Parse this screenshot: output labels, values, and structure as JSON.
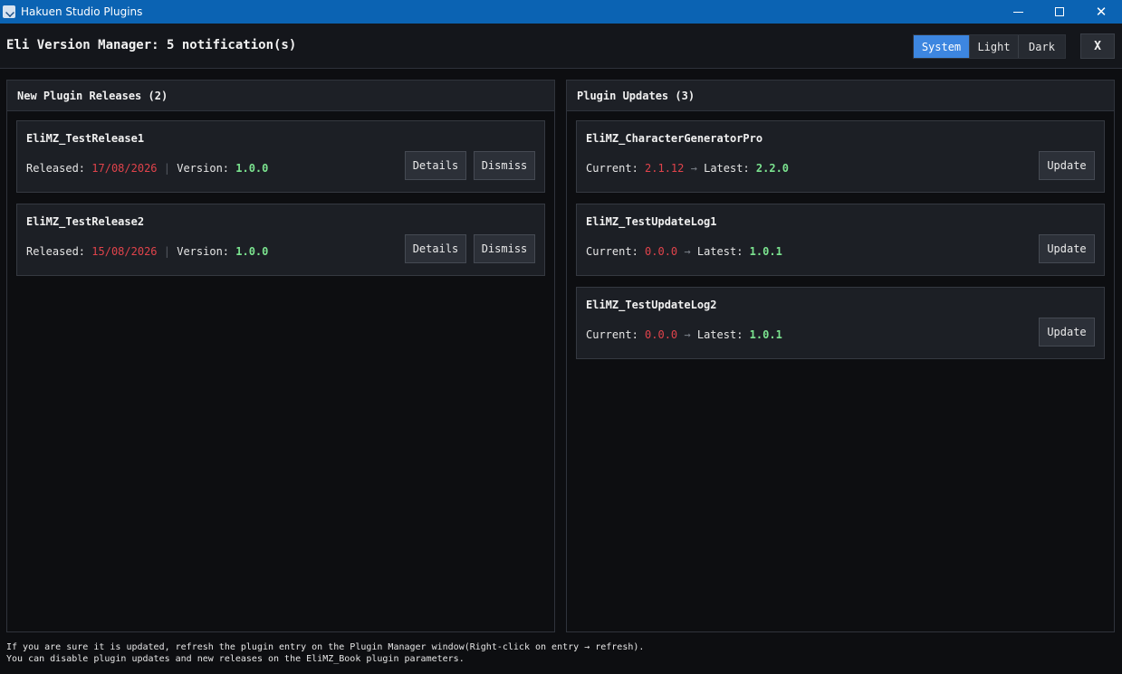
{
  "window": {
    "title": "Hakuen Studio Plugins",
    "minimize_icon": "minimize-icon",
    "maximize_icon": "maximize-icon",
    "close_glyph": "✕"
  },
  "header": {
    "title": "Eli Version Manager: 5 notification(s)",
    "themes": {
      "system": "System",
      "light": "Light",
      "dark": "Dark",
      "selected": "System"
    },
    "close_label": "X"
  },
  "new_releases": {
    "title": "New Plugin Releases (2)",
    "items": [
      {
        "name": "EliMZ_TestRelease1",
        "released_label": "Released:",
        "released_date": "17/08/2026",
        "separator": "|",
        "version_label": "Version:",
        "version": "1.0.0",
        "details_label": "Details",
        "dismiss_label": "Dismiss"
      },
      {
        "name": "EliMZ_TestRelease2",
        "released_label": "Released:",
        "released_date": "15/08/2026",
        "separator": "|",
        "version_label": "Version:",
        "version": "1.0.0",
        "details_label": "Details",
        "dismiss_label": "Dismiss"
      }
    ]
  },
  "updates": {
    "title": "Plugin Updates (3)",
    "items": [
      {
        "name": "EliMZ_CharacterGeneratorPro",
        "current_label": "Current:",
        "current": "2.1.12",
        "arrow": "→",
        "latest_label": "Latest:",
        "latest": "2.2.0",
        "update_label": "Update"
      },
      {
        "name": "EliMZ_TestUpdateLog1",
        "current_label": "Current:",
        "current": "0.0.0",
        "arrow": "→",
        "latest_label": "Latest:",
        "latest": "1.0.1",
        "update_label": "Update"
      },
      {
        "name": "EliMZ_TestUpdateLog2",
        "current_label": "Current:",
        "current": "0.0.0",
        "arrow": "→",
        "latest_label": "Latest:",
        "latest": "1.0.1",
        "update_label": "Update"
      }
    ]
  },
  "footer": {
    "line1": "If you are sure it is updated, refresh the plugin entry on the Plugin Manager window(Right-click on entry → refresh).",
    "line2": "You can disable plugin updates and new releases on the EliMZ_Book plugin parameters."
  },
  "colors": {
    "accent": "#3d86e0",
    "titlebar": "#0b63b3",
    "old_value": "#e0434b",
    "new_value": "#7be38f"
  }
}
